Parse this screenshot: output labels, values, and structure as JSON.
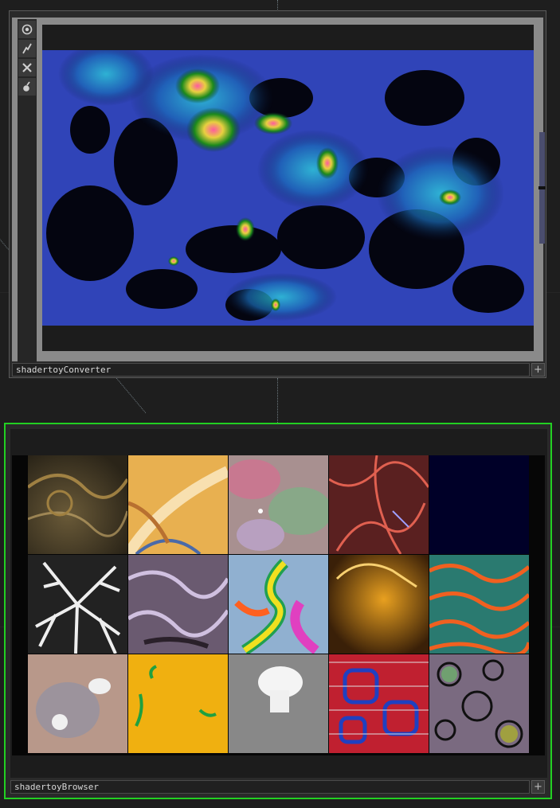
{
  "converter_node": {
    "name": "shadertoyConverter",
    "tools": [
      {
        "icon": "viewer-eye-icon"
      },
      {
        "icon": "bypass-lightning-icon"
      },
      {
        "icon": "close-x-icon"
      },
      {
        "icon": "lock-icon"
      }
    ],
    "plus_label": "+"
  },
  "browser_node": {
    "name": "shadertoyBrowser",
    "plus_label": "+",
    "thumbnails": [
      {
        "icon": "shader-thumbnail-brown-swirl"
      },
      {
        "icon": "shader-thumbnail-orange-feather"
      },
      {
        "icon": "shader-thumbnail-pastel-fluid"
      },
      {
        "icon": "shader-thumbnail-red-veins"
      },
      {
        "icon": "shader-thumbnail-dark-navy"
      },
      {
        "icon": "shader-thumbnail-white-branches"
      },
      {
        "icon": "shader-thumbnail-purple-liquid"
      },
      {
        "icon": "shader-thumbnail-rainbow-fluid"
      },
      {
        "icon": "shader-thumbnail-golden-cave"
      },
      {
        "icon": "shader-thumbnail-orange-teal-tentacles"
      },
      {
        "icon": "shader-thumbnail-soft-spheres"
      },
      {
        "icon": "shader-thumbnail-yellow-green-ink"
      },
      {
        "icon": "shader-thumbnail-grey-mushroom"
      },
      {
        "icon": "shader-thumbnail-red-blue-pattern"
      },
      {
        "icon": "shader-thumbnail-mineral-cells"
      }
    ]
  },
  "colors": {
    "selected_border": "#22d022",
    "node_border": "#5b5b5b",
    "background": "#1e1e1e"
  }
}
